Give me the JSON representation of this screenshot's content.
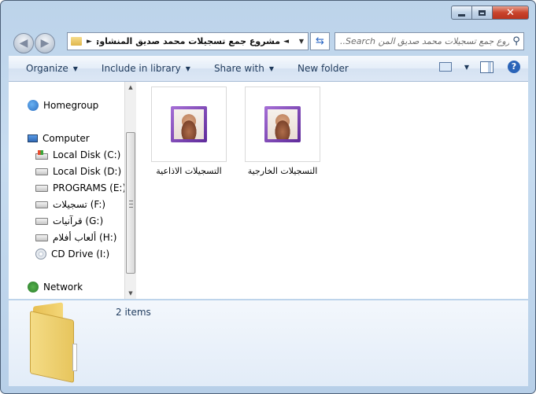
{
  "titlebar": {
    "minimize": "minimize",
    "maximize": "maximize",
    "close": "close"
  },
  "address": {
    "path": "مشروع جمع تسجيلات محمد صديق المنشاوى"
  },
  "search": {
    "placeholder": "..Search مشروع جمع تسجيلات محمد صديق المن"
  },
  "toolbar": {
    "organize": "Organize",
    "include_in_library": "Include in library",
    "share_with": "Share with",
    "new_folder": "New folder"
  },
  "nav": {
    "homegroup": "Homegroup",
    "computer": "Computer",
    "drives": [
      "Local Disk (C:)",
      "Local Disk (D:)",
      "PROGRAMS (E:)",
      "تسجيلات (F:)",
      "قرآنيات (G:)",
      "ألعاب أفلام (H:)",
      "CD Drive (I:)"
    ],
    "network": "Network"
  },
  "files": [
    {
      "name": "التسجيلات الاذاعية"
    },
    {
      "name": "التسجيلات الخارجية"
    }
  ],
  "details": {
    "item_count": "2 items"
  },
  "colors": {
    "frame": "#c7dcf0",
    "toolbar_text": "#1e395b",
    "close_red": "#c9442c",
    "folder_yellow": "#f4d779",
    "thumbnail_purple": "#5e2a9a"
  }
}
